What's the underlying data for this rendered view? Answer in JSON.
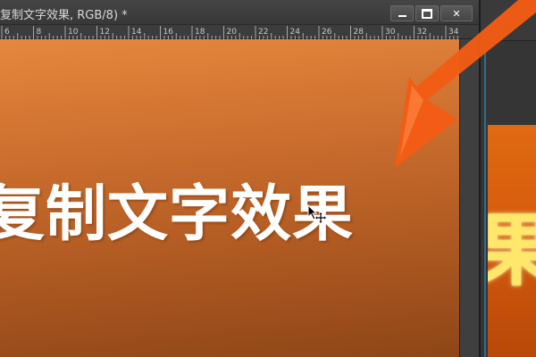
{
  "document": {
    "title": "复制文字效果, RGB/8) *",
    "window_buttons": {
      "minimize": "minimize",
      "maximize": "maximize",
      "close": "✕"
    }
  },
  "ruler": {
    "labels": [
      "6",
      "8",
      "10",
      "12",
      "14",
      "16",
      "18",
      "20",
      "22",
      "24",
      "26",
      "28",
      "30",
      "32",
      "34"
    ]
  },
  "canvas": {
    "text": "复制文字效果"
  },
  "second_window": {
    "text": "果"
  },
  "colors": {
    "canvas_top": "#e5883d",
    "canvas_bottom": "#8e4617",
    "arrow": "#f25c14",
    "glow_text": "#ffe76a"
  },
  "icons": {
    "cursor": "move-cursor-icon",
    "arrow": "annotation-arrow"
  }
}
